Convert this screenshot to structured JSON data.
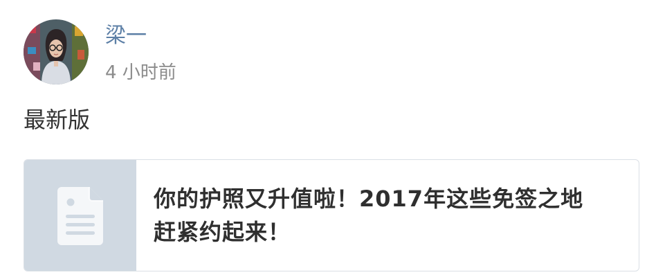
{
  "post": {
    "author": {
      "name": "梁一",
      "avatar_icon": "user-avatar"
    },
    "time": "4 小时前",
    "text": "最新版",
    "link_card": {
      "title_line1": "你的护照又升值啦！2017年这些免签之地",
      "title_line2": "赶紧约起来！",
      "thumbnail_icon": "document-icon"
    }
  },
  "colors": {
    "author_name": "#5c7fa6",
    "time": "#8b8b8b",
    "body_text": "#333333",
    "thumb_bg": "#d0d9e2",
    "card_border": "#dadfe5"
  }
}
